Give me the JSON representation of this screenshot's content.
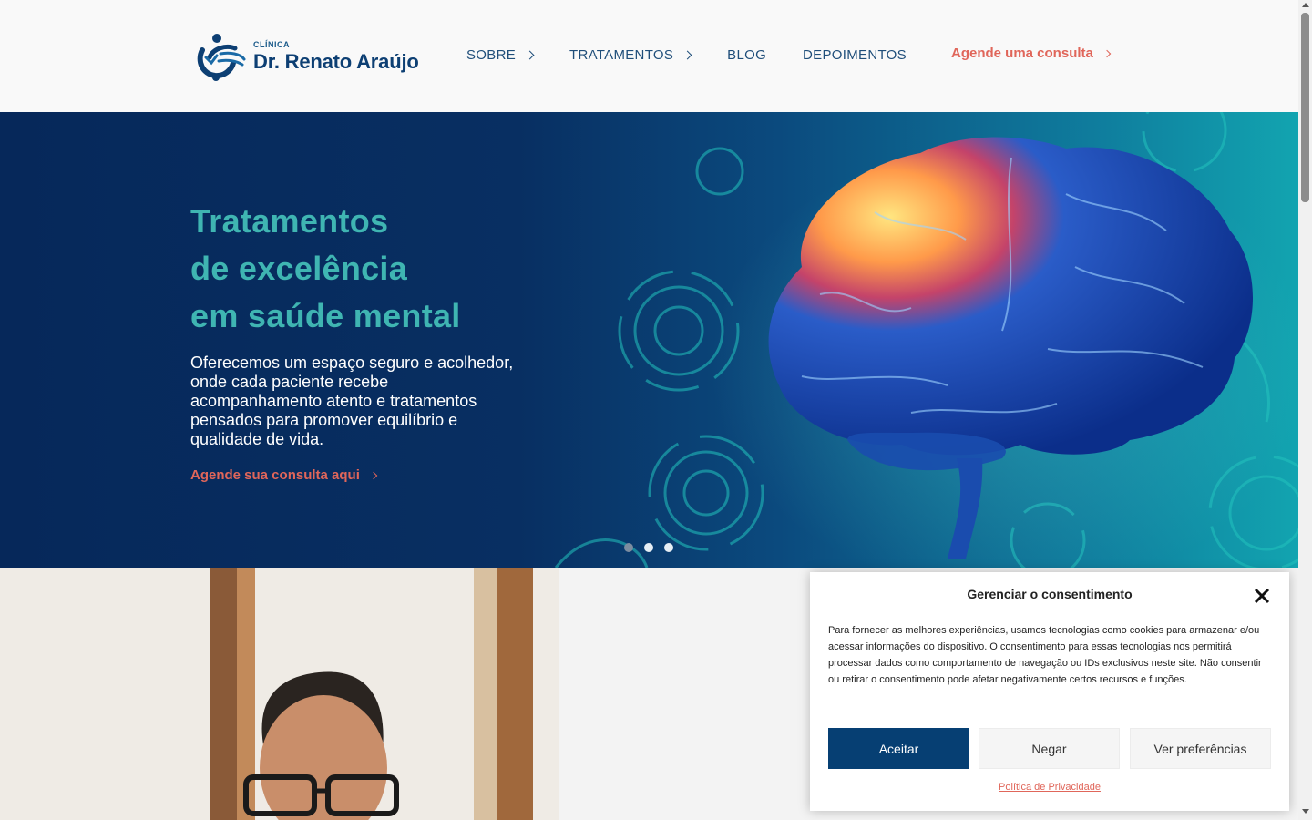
{
  "header": {
    "logo_small": "CLÍNICA",
    "logo_name": "Dr. Renato Araújo",
    "nav": [
      {
        "label": "SOBRE",
        "has_submenu": true
      },
      {
        "label": "TRATAMENTOS",
        "has_submenu": true
      },
      {
        "label": "BLOG",
        "has_submenu": false
      },
      {
        "label": "DEPOIMENTOS",
        "has_submenu": false
      }
    ],
    "cta": "Agende uma consulta"
  },
  "hero": {
    "title_lines": [
      "Tratamentos",
      "de excelência",
      "em saúde mental"
    ],
    "subtitle": "Oferecemos um espaço seguro e acolhedor, onde cada paciente recebe acompanhamento atento e tratamentos pensados para promover equilíbrio e qualidade de vida.",
    "cta": "Agende sua consulta aqui",
    "slides_total": 3,
    "active_slide": 1
  },
  "consent": {
    "title": "Gerenciar o consentimento",
    "text": "Para fornecer as melhores experiências, usamos tecnologias como cookies para armazenar e/ou acessar informações do dispositivo. O consentimento para essas tecnologias nos permitirá processar dados como comportamento de navegação ou IDs exclusivos neste site. Não consentir ou retirar o consentimento pode afetar negativamente certos recursos e funções.",
    "accept": "Aceitar",
    "deny": "Negar",
    "preferences": "Ver preferências",
    "policy_link": "Política de Privacidade"
  },
  "colors": {
    "brand_navy": "#063f73",
    "accent_coral": "#e0665a",
    "teal": "#3fb5b2"
  }
}
